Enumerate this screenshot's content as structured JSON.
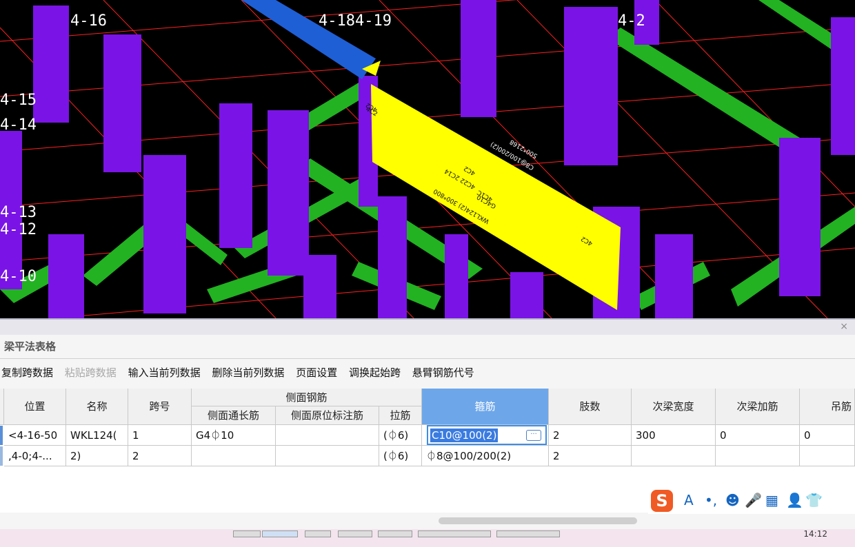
{
  "viewport": {
    "axis_labels": [
      "4-16",
      "4-184-19",
      "4-15",
      "4-14",
      "4-13",
      "4-12",
      "4-10",
      "4-2"
    ],
    "beam_annotations": [
      "4C2",
      "4C2",
      "4C2",
      "4C2",
      "4C1C",
      "500*2168",
      "C8@100/200(2)",
      "WKL124(2) 300*800",
      "G4C10",
      "4C22 2C14"
    ],
    "colors": {
      "background": "#000000",
      "column": "#7a14e6",
      "beam": "#22b222",
      "selected_beam": "#ffff00",
      "active_beam": "#1e5fd6",
      "axis": "#ff2020"
    }
  },
  "panel": {
    "title": "梁平法表格",
    "close_glyph": "×",
    "toolbar": [
      "复制跨数据",
      "粘贴跨数据",
      "输入当前列数据",
      "删除当前列数据",
      "页面设置",
      "调换起始跨",
      "悬臂钢筋代号"
    ],
    "headers": {
      "position": "位置",
      "name": "名称",
      "span": "跨号",
      "side_group": "侧面钢筋",
      "side_long": "侧面通长筋",
      "side_orig": "侧面原位标注筋",
      "tie": "拉筋",
      "stirrup": "箍筋",
      "legs": "肢数",
      "sec_width": "次梁宽度",
      "sec_add": "次梁加筋",
      "hanger": "吊筋"
    },
    "rows": [
      {
        "position": "<4-16-50",
        "name": "WKL124(",
        "span": "1",
        "side_long": "G4⏀10",
        "side_orig": "",
        "tie": "(⏀6)",
        "stirrup": "C10@100(2)",
        "legs": "2",
        "sec_width": "300",
        "sec_add": "0",
        "hanger": "0"
      },
      {
        "position": ",4-0;4-...",
        "name": "2)",
        "span": "2",
        "side_long": "",
        "side_orig": "",
        "tie": "(⏀6)",
        "stirrup": "⏀8@100/200(2)",
        "legs": "2",
        "sec_width": "",
        "sec_add": "",
        "hanger": ""
      }
    ],
    "editor_button": "···"
  },
  "ime": {
    "logo": "S",
    "items": [
      "A",
      "•,",
      "☻",
      "🎤",
      "▦",
      "👤",
      "👕"
    ]
  },
  "taskbar": {
    "clock": "14:12"
  }
}
